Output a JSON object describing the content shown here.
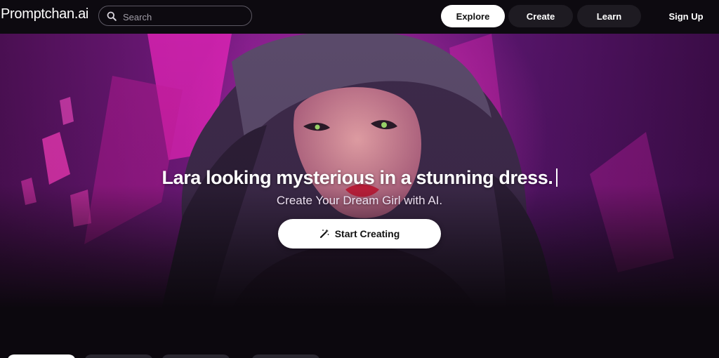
{
  "header": {
    "logo_brand": "Promptchan",
    "logo_tld": ".ai",
    "search_placeholder": "Search",
    "nav": {
      "explore": "Explore",
      "create": "Create",
      "learn": "Learn",
      "sign_up": "Sign Up"
    }
  },
  "hero": {
    "headline": "Lara looking mysterious in a stunning dress.",
    "subtitle": "Create Your Dream Girl with AI.",
    "cta_label": "Start Creating",
    "cta_icon": "magic-wand-icon"
  },
  "colors": {
    "background": "#0c080e",
    "accent_magenta": "#e020b0",
    "hero_purple": "#6a1a88",
    "nav_pill": "#1e1b22"
  }
}
